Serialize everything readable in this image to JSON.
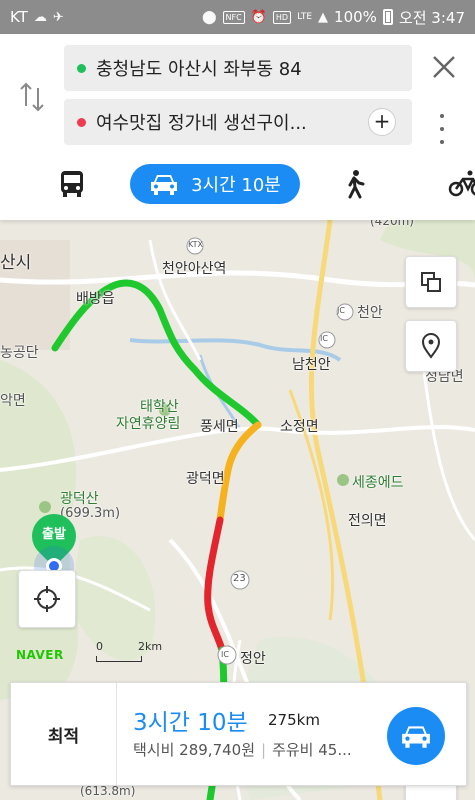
{
  "status_bar": {
    "carrier": "KT",
    "lte": "LTE",
    "battery": "100%",
    "time": "오전 3:47"
  },
  "search": {
    "origin": "충청남도 아산시 좌부동 84",
    "destination": "여수맛집 정가네 생선구이...",
    "origin_color": "#1fbf5c",
    "destination_color": "#ee3b4f"
  },
  "modes": {
    "car_label": "3시간 10분",
    "selected": "car",
    "accent": "#1c8cf5"
  },
  "map": {
    "labels": {
      "asan": "산시",
      "baebang": "배방읍",
      "cheonan_asan_station": "천안아산역",
      "ktx": "KTX",
      "jc_cheonan": "천안",
      "ic1": "IC",
      "namcheonan": "남천안",
      "nongongdan": "농공단",
      "akmyeon": "악면",
      "taehaksan": "태학산",
      "forest": "자연휴양림",
      "pungse": "풍세면",
      "sojeong": "소정면",
      "jeongam": "정담면",
      "gwangdeok": "광덕면",
      "sejong": "세종에드",
      "gwangdeoksan": "광덕산",
      "gwangdeoksan_h": "(699.3m)",
      "jeonui": "전의면",
      "route23": "23",
      "ic2": "IC",
      "jeongan": "정안",
      "dist_420": "(420m)",
      "bottom_peak": "(613.8m)"
    },
    "start_label": "출발",
    "naver_logo": "NAVER",
    "scale_zero": "0",
    "scale_label": "2km",
    "route_colors": {
      "smooth": "#1ec82d",
      "slow": "#f5b21e",
      "jam": "#e3262e"
    }
  },
  "summary": {
    "option_label": "최적",
    "duration": "3시간 10분",
    "distance": "275km",
    "taxi_fare": "택시비 289,740원",
    "fuel": "주유비 45..."
  }
}
